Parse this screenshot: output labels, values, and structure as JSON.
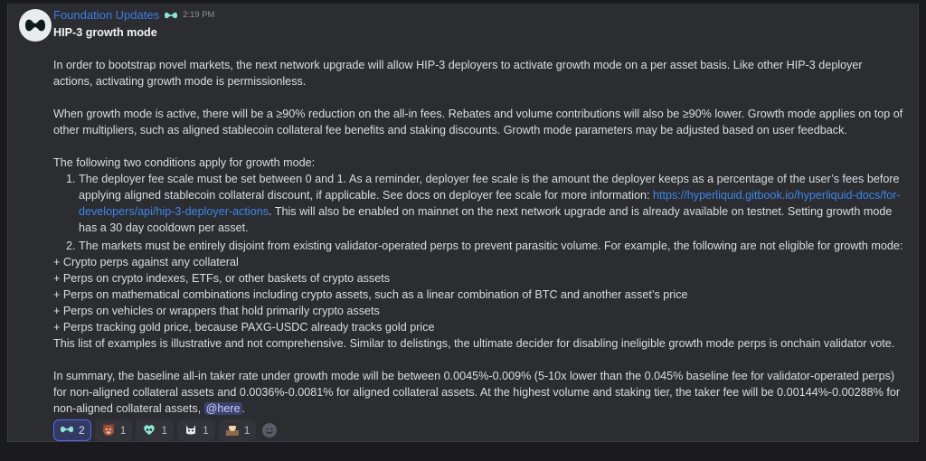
{
  "author": {
    "name": "Foundation Updates",
    "timestamp": "2:19 PM",
    "badge_icon": "hyperliquid-logo-icon"
  },
  "message": {
    "title": "HIP-3 growth mode",
    "p1": "In order to bootstrap novel markets, the next network upgrade will allow HIP-3 deployers to activate growth mode on a per asset basis. Like other HIP-3 deployer actions, activating growth mode is permissionless.",
    "p2": "When growth mode is active, there will be a ≥90% reduction on the all-in fees. Rebates and volume contributions will also be ≥90% lower. Growth mode applies on top of other multipliers, such as aligned stablecoin collateral fee benefits and staking discounts. Growth mode parameters may be adjusted based on user feedback.",
    "p3": "The following two conditions apply for growth mode:",
    "item1": {
      "num": "1.",
      "text_a": "The deployer fee scale must be set between 0 and 1. As a reminder, deployer fee scale is the amount the deployer keeps as a percentage of the user’s fees before applying aligned stablecoin collateral discount, if applicable. See docs on deployer fee scale for more information: ",
      "link": "https://hyperliquid.gitbook.io/hyperliquid-docs/for-developers/api/hip-3-deployer-actions",
      "text_b": ". This will also be enabled on mainnet on the next network upgrade and is already available on testnet. Setting growth mode has a 30 day cooldown per asset."
    },
    "item2": {
      "num": "2.",
      "text": "The markets must be entirely disjoint from existing validator-operated perps to prevent parasitic volume. For example, the following are not eligible for growth mode:"
    },
    "bullets": [
      "+ Crypto perps against any collateral",
      "+ Perps on crypto indexes, ETFs, or other baskets of crypto assets",
      "+ Perps on mathematical combinations including crypto assets, such as a linear combination of BTC and another asset’s price",
      "+ Perps on vehicles or wrappers that hold primarily crypto assets",
      "+ Perps tracking gold price, because PAXG-USDC already tracks gold price"
    ],
    "p4": "This list of examples is illustrative and not comprehensive. Similar to delistings, the ultimate decider for disabling ineligible growth mode perps is onchain validator vote.",
    "p5": "In summary, the baseline all-in taker rate under growth mode will be between 0.0045%-0.009% (5-10x lower than the 0.045% baseline fee for validator-operated perps) for non-aligned collateral assets and 0.0036%-0.0081% for aligned collateral assets. At the highest volume and staking tier, the taker fee will be 0.00144%-0.00288% for non-aligned collateral assets, ",
    "mention": "@here",
    "p5_end": "."
  },
  "reactions": [
    {
      "icon": "hyperliquid-logo-icon",
      "count": "2",
      "active": true
    },
    {
      "icon": "bear-icon",
      "count": "1",
      "active": false
    },
    {
      "icon": "heart-logo-icon",
      "count": "1",
      "active": false
    },
    {
      "icon": "cat-icon",
      "count": "1",
      "active": false
    },
    {
      "icon": "character-icon",
      "count": "1",
      "active": false
    }
  ],
  "colors": {
    "background": "#2b2d31",
    "username": "#3f7de8",
    "link": "#3f86e8",
    "mention_bg": "#3c4270",
    "active_reaction_border": "#5865f2"
  }
}
